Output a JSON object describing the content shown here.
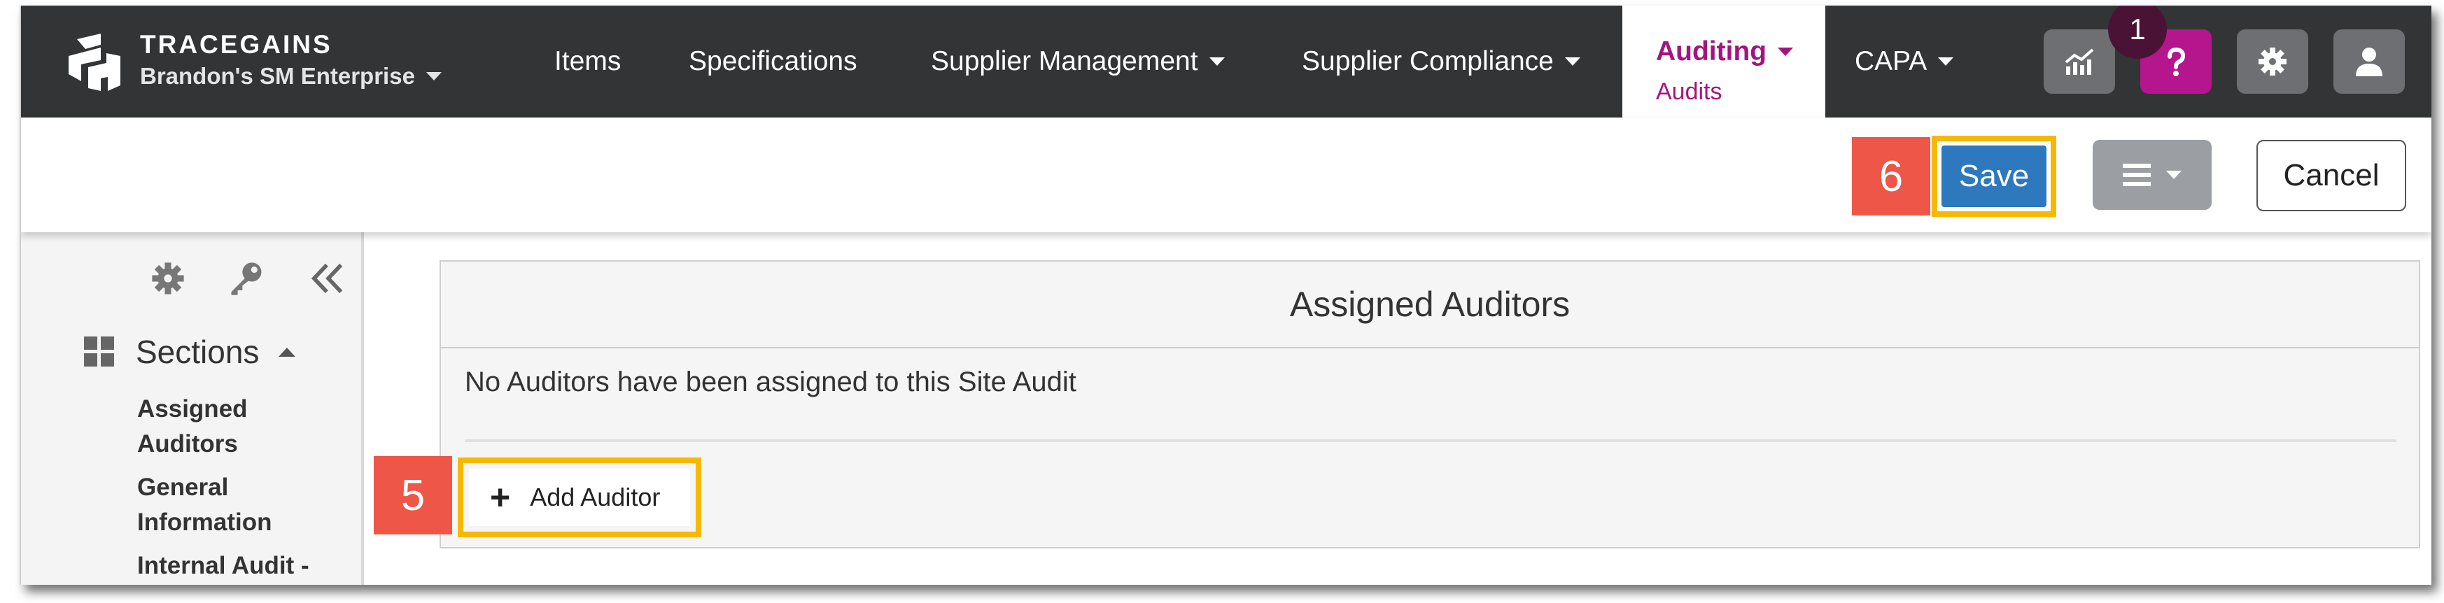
{
  "brand": {
    "name": "TRACEGAINS",
    "enterprise": "Brandon's SM Enterprise",
    "logo_icon": "tracegains-logo-icon"
  },
  "nav": {
    "items": [
      {
        "label": "Items"
      },
      {
        "label": "Specifications"
      },
      {
        "label": "Supplier Management",
        "dropdown": true
      },
      {
        "label": "Supplier Compliance",
        "dropdown": true
      },
      {
        "label": "Auditing",
        "sublabel": "Audits",
        "dropdown": true,
        "active": true
      },
      {
        "label": "CAPA",
        "dropdown": true
      }
    ],
    "active_color": "#a4147f",
    "icons": [
      "analytics-icon",
      "help-icon",
      "gear-icon",
      "user-icon"
    ],
    "help_badge": "1"
  },
  "toolbar": {
    "step_save": "6",
    "save_label": "Save",
    "menu_icon": "hamburger-icon",
    "cancel_label": "Cancel"
  },
  "sidebar": {
    "tools": [
      "gear-icon",
      "key-icon",
      "collapse-icon"
    ],
    "sections_label": "Sections",
    "items": [
      {
        "label": "Assigned Auditors"
      },
      {
        "label": "General Information"
      },
      {
        "label": "Internal Audit -"
      }
    ]
  },
  "panel": {
    "title": "Assigned Auditors",
    "empty_message": "No Auditors have been assigned to this Site Audit",
    "step_add": "5",
    "add_label": "Add Auditor"
  },
  "colors": {
    "nav_bg": "#333435",
    "accent": "#b5158d",
    "primary": "#2e79bd",
    "highlight": "#f6b800",
    "step_badge": "#ee5648"
  }
}
